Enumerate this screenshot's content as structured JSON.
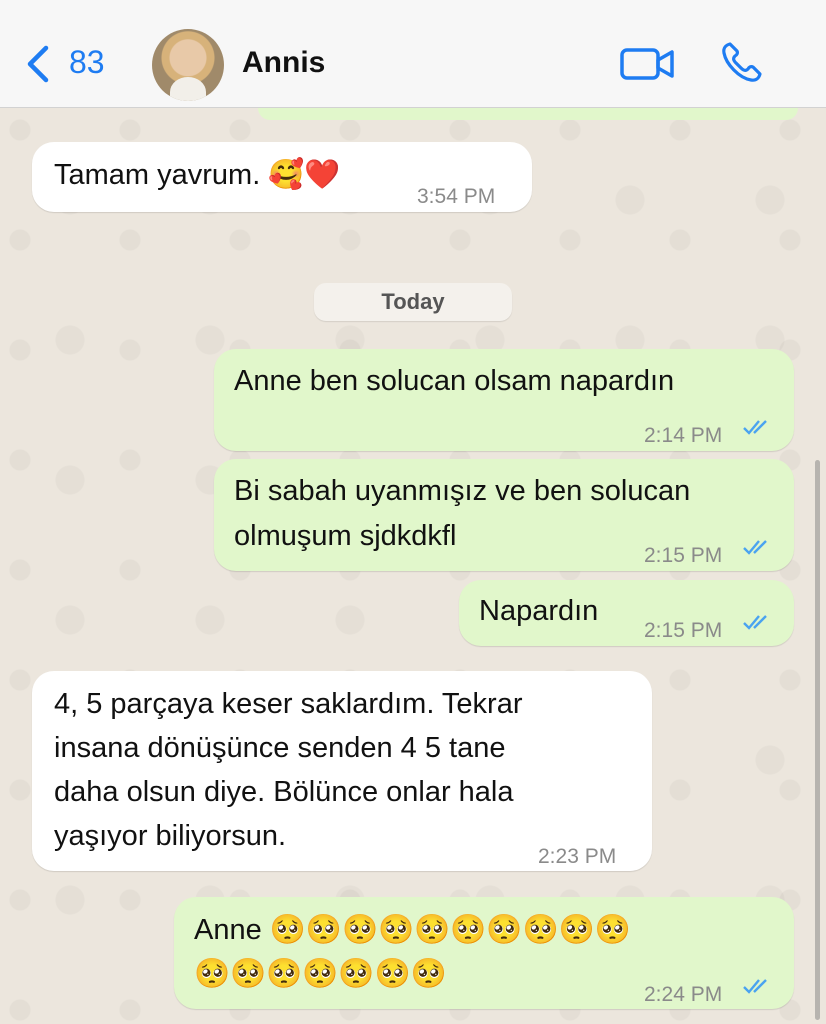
{
  "header": {
    "back_count": "83",
    "contact_name": "Annis"
  },
  "day_separator": "Today",
  "messages": [
    {
      "direction": "in",
      "text": "Tamam yavrum. 🥰❤️",
      "time": "3:54 PM"
    },
    {
      "direction": "out",
      "lines": [
        "Anne ben solucan olsam napardın"
      ],
      "time": "2:14 PM",
      "status": "read"
    },
    {
      "direction": "out",
      "lines": [
        "Bi sabah uyanmışız ve ben solucan",
        "olmuşum sjdkdkfl"
      ],
      "time": "2:15 PM",
      "status": "read"
    },
    {
      "direction": "out",
      "lines": [
        "Napardın"
      ],
      "time": "2:15 PM",
      "status": "read"
    },
    {
      "direction": "in",
      "lines": [
        "4, 5 parçaya keser saklardım. Tekrar",
        "insana dönüşünce senden 4  5 tane",
        "daha olsun diye. Bölünce onlar hala",
        "yaşıyor biliyorsun."
      ],
      "time": "2:23 PM"
    },
    {
      "direction": "out",
      "lines": [
        "Anne 🥺🥺🥺🥺🥺🥺🥺🥺🥺🥺",
        "🥺🥺🥺🥺🥺🥺🥺"
      ],
      "time": "2:24 PM",
      "status": "read"
    }
  ],
  "colors": {
    "accent": "#1e7cf2",
    "outgoing_bubble": "#e1f7cb",
    "incoming_bubble": "#ffffff",
    "read_ticks": "#4aa3f0"
  }
}
